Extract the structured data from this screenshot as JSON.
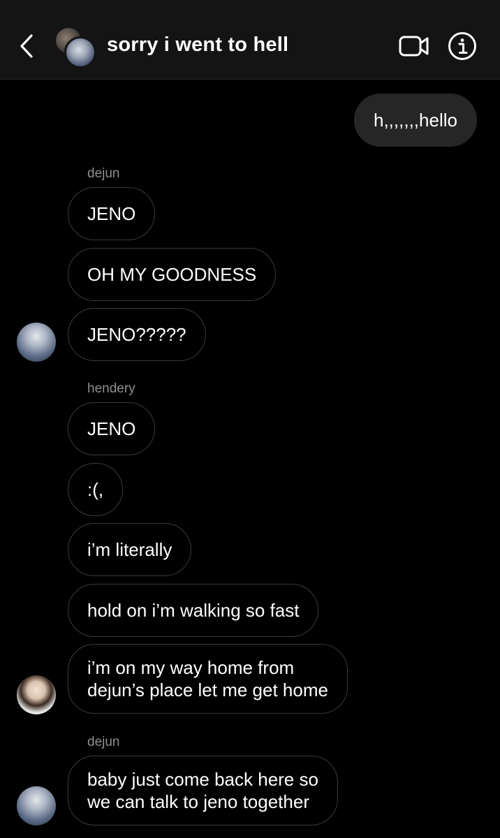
{
  "header": {
    "title": "sorry i went to hell",
    "back_icon": "chevron-left-icon",
    "video_icon": "video-camera-icon",
    "info_icon": "info-icon"
  },
  "colors": {
    "background": "#000000",
    "header_background": "#141414",
    "outgoing_bubble": "#262626",
    "incoming_border": "#3a3a3a",
    "sender_text": "#8e8e8e"
  },
  "messages": [
    {
      "type": "outgoing",
      "text": "h,,,,,,,hello"
    },
    {
      "type": "sender",
      "text": "dejun"
    },
    {
      "type": "incoming",
      "text": "JENO"
    },
    {
      "type": "incoming",
      "text": "OH MY GOODNESS"
    },
    {
      "type": "incoming",
      "text": "JENO?????"
    },
    {
      "type": "sender",
      "text": "hendery"
    },
    {
      "type": "incoming",
      "text": "JENO"
    },
    {
      "type": "incoming",
      "text": ":(,"
    },
    {
      "type": "incoming",
      "text": "i’m literally"
    },
    {
      "type": "incoming",
      "text": "hold on i’m walking so fast"
    },
    {
      "type": "incoming",
      "lines": [
        "i’m on my way home from",
        "dejun’s place let me get home"
      ]
    },
    {
      "type": "sender",
      "text": "dejun"
    },
    {
      "type": "incoming",
      "lines": [
        "baby just come back here so",
        "we can talk to jeno together"
      ]
    }
  ]
}
